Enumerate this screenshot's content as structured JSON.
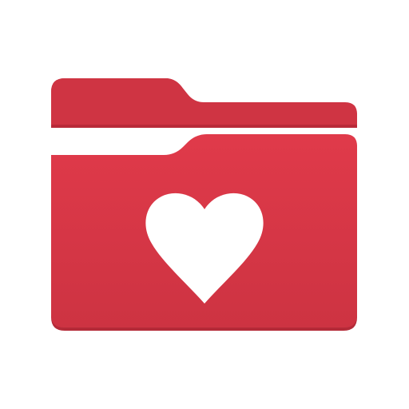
{
  "icon": {
    "name": "favorites-folder-icon",
    "glyph": "heart-icon",
    "colors": {
      "background": "#ffffff",
      "folder_back": "#cf3443",
      "folder_back_edge": "#b92a39",
      "folder_front_top": "#e03a4a",
      "folder_front_bottom": "#cd3342",
      "folder_front_edge": "#b42a38",
      "heart": "#ffffff"
    }
  }
}
